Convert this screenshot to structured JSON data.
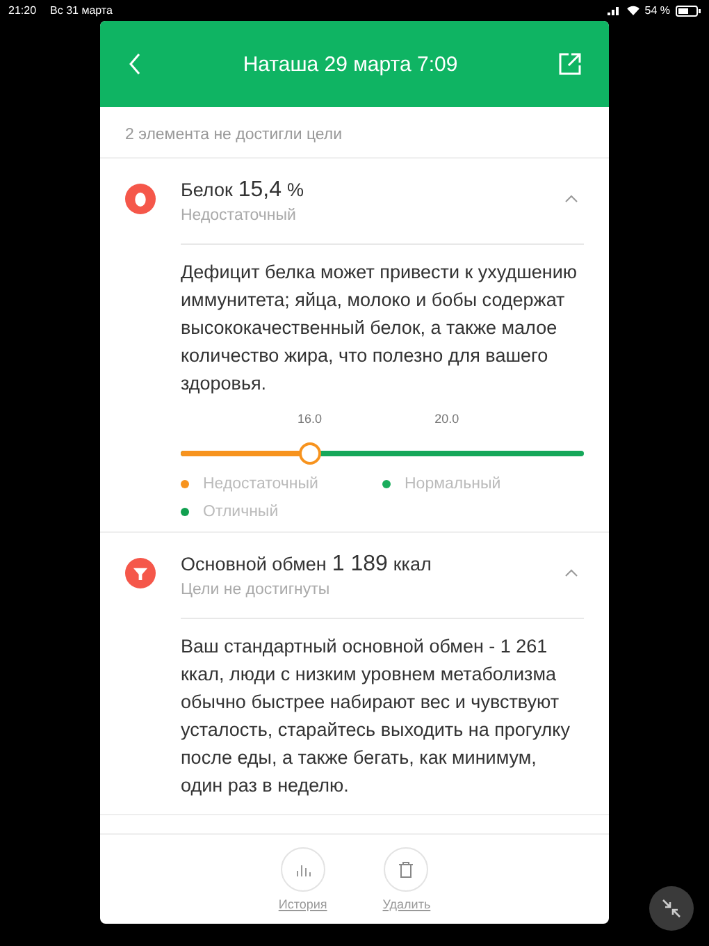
{
  "status_bar": {
    "time": "21:20",
    "date": "Вс 31 марта",
    "battery": "54 %"
  },
  "header": {
    "title": "Наташа 29 марта 7:09"
  },
  "summary": "2 элемента не достигли цели",
  "items": [
    {
      "kind": "protein",
      "label": "Белок",
      "value": "15,4",
      "unit": "%",
      "status": "Недостаточный",
      "expanded": true,
      "text": "Дефицит белка может привести к ухудшению иммунитета; яйца, молоко и бобы содержат высококачественный белок, а также малое количество жира, что полезно для вашего здоровья.",
      "scale": {
        "level": 0.32,
        "ticks": [
          "16.0",
          "20.0"
        ],
        "legend": [
          {
            "label": "Недостаточный",
            "color": "#f7931e"
          },
          {
            "label": "Нормальный",
            "color": "#1aad5c"
          },
          {
            "label": "Отличный",
            "color": "#11a050"
          }
        ]
      }
    },
    {
      "kind": "metabolism",
      "label": "Основной обмен",
      "value": "1 189",
      "unit": "ккал",
      "status": "Цели не достигнуты",
      "expanded": true,
      "text": "Ваш стандартный основной обмен - 1 261 ккал, люди с низким уровнем метаболизма обычно быстрее набирают вес и чувствуют усталость, старайтесь выходить на прогулку после еды, а также бегать, как минимум, один раз в неделю."
    }
  ],
  "footer": [
    {
      "kind": "history",
      "label": "История"
    },
    {
      "kind": "delete",
      "label": "Удалить"
    }
  ]
}
